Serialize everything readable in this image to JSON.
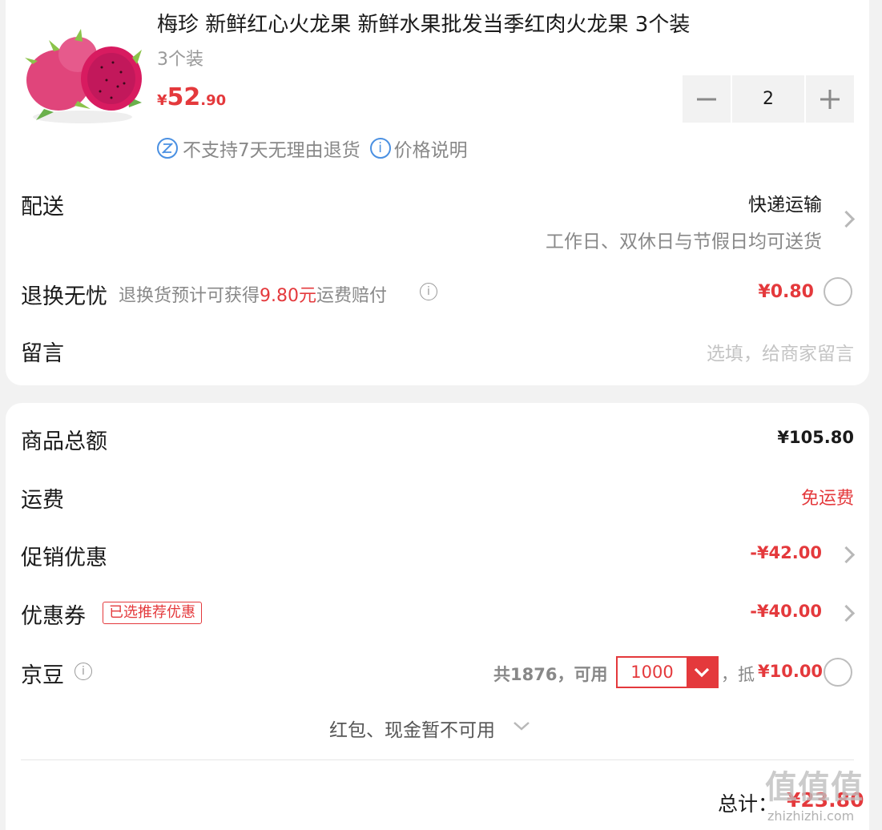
{
  "product": {
    "image_alt": "红心火龙果",
    "title": "梅珍 新鲜红心火龙果 新鲜水果批发当季红肉火龙果 3个装",
    "spec": "3个装",
    "price_currency": "¥",
    "price_int": "52",
    "price_dec": ".90",
    "quantity": "2",
    "return_policy": "不支持7天无理由退货",
    "price_note": "价格说明"
  },
  "delivery": {
    "label": "配送",
    "method": "快递运输",
    "schedule": "工作日、双休日与节假日均可送货"
  },
  "return_worry": {
    "label": "退换无忧",
    "desc_prefix": "退换货预计可获得",
    "desc_amount": "9.80元",
    "desc_suffix": "运费赔付",
    "price": "¥0.80"
  },
  "message": {
    "label": "留言",
    "placeholder": "选填，给商家留言"
  },
  "summary": {
    "goods_total_label": "商品总额",
    "goods_total_value": "¥105.80",
    "shipping_label": "运费",
    "shipping_value": "免运费",
    "promo_label": "促销优惠",
    "promo_value": "-¥42.00",
    "coupon_label": "优惠券",
    "coupon_tag": "已选推荐优惠",
    "coupon_value": "-¥40.00",
    "beans_label": "京豆",
    "beans_total": "共1876，可用",
    "beans_selected": "1000",
    "beans_sep": "，",
    "beans_deduct_prefix": "抵",
    "beans_deduct_value": "¥10.00",
    "redpacket_note": "红包、现金暂不可用",
    "total_label": "总计：",
    "total_value": "¥23.80"
  },
  "watermark": {
    "logo_text": "值值值",
    "site": "zhizhizhi.com"
  },
  "colors": {
    "accent": "#e4393c",
    "info_blue": "#4a90e2"
  }
}
